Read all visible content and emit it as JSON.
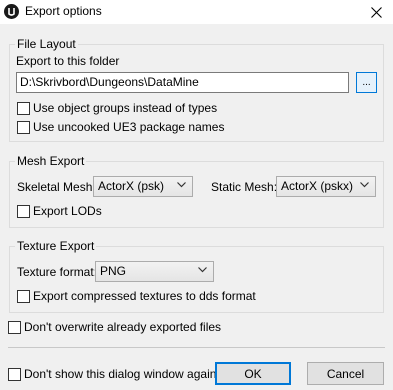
{
  "window": {
    "title": "Export options",
    "close_icon": "close-icon"
  },
  "file_layout": {
    "legend": "File Layout",
    "export_folder_label": "Export to this folder",
    "folder_path": "D:\\Skrivbord\\Dungeons\\DataMine",
    "browse_label": "...",
    "use_object_groups": {
      "label": "Use object groups instead of types",
      "checked": false
    },
    "use_uncooked_names": {
      "label": "Use uncooked UE3 package names",
      "checked": false
    }
  },
  "mesh_export": {
    "legend": "Mesh Export",
    "skeletal_label": "Skeletal Mesh:",
    "skeletal_value": "ActorX (psk)",
    "static_label": "Static Mesh:",
    "static_value": "ActorX (pskx)",
    "export_lods": {
      "label": "Export LODs",
      "checked": false
    }
  },
  "texture_export": {
    "legend": "Texture Export",
    "format_label": "Texture format:",
    "format_value": "PNG",
    "export_compressed": {
      "label": "Export compressed textures to dds format",
      "checked": false
    }
  },
  "dont_overwrite": {
    "label": "Don't overwrite already exported files",
    "checked": false
  },
  "dont_show_again": {
    "label": "Don't show this dialog window again",
    "checked": false
  },
  "buttons": {
    "ok": "OK",
    "cancel": "Cancel"
  },
  "colors": {
    "accent": "#0078d7",
    "window_bg": "#f0f0f0"
  }
}
